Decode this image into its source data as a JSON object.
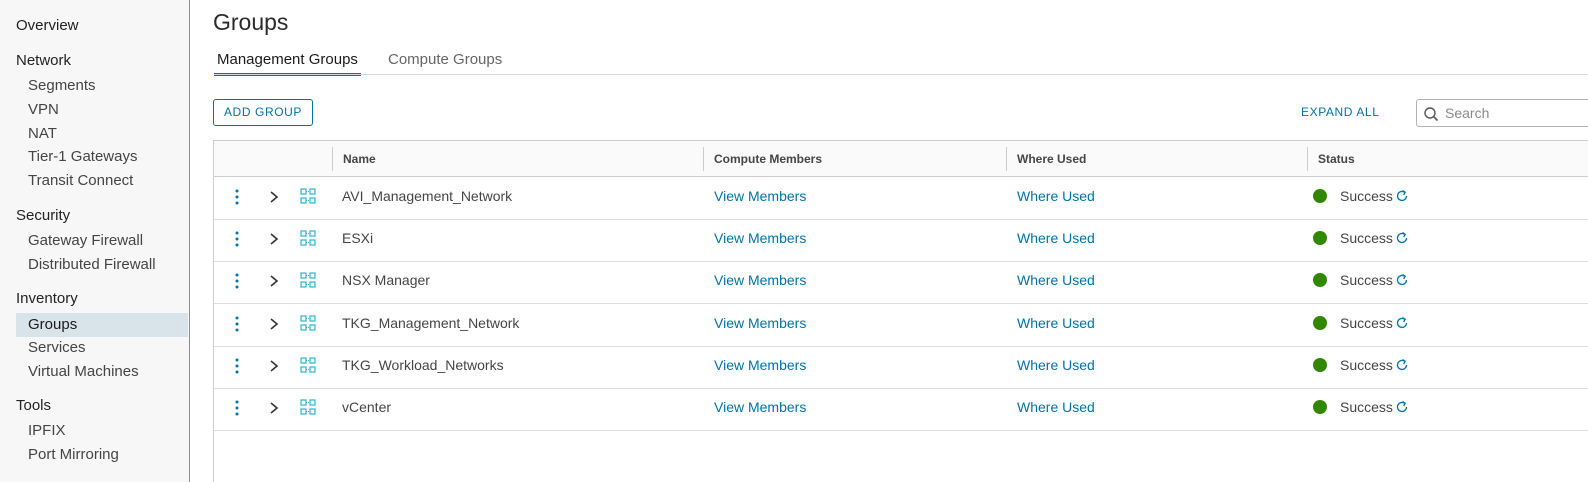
{
  "sidebar": {
    "overview": "Overview",
    "sections": [
      {
        "title": "Network",
        "items": [
          "Segments",
          "VPN",
          "NAT",
          "Tier-1 Gateways",
          "Transit Connect"
        ]
      },
      {
        "title": "Security",
        "items": [
          "Gateway Firewall",
          "Distributed Firewall"
        ]
      },
      {
        "title": "Inventory",
        "items": [
          "Groups",
          "Services",
          "Virtual Machines"
        ]
      },
      {
        "title": "Tools",
        "items": [
          "IPFIX",
          "Port Mirroring"
        ]
      }
    ],
    "active_item": "Groups"
  },
  "page": {
    "title": "Groups",
    "tabs": [
      {
        "label": "Management Groups",
        "active": true
      },
      {
        "label": "Compute Groups",
        "active": false
      }
    ],
    "add_group_label": "ADD GROUP",
    "expand_all_label": "EXPAND ALL",
    "search_placeholder": "Search"
  },
  "grid": {
    "columns": [
      "Name",
      "Compute Members",
      "Where Used",
      "Status"
    ],
    "rows": [
      {
        "name": "AVI_Management_Network",
        "members": "View Members",
        "where_used": "Where Used",
        "status": "Success"
      },
      {
        "name": "ESXi",
        "members": "View Members",
        "where_used": "Where Used",
        "status": "Success"
      },
      {
        "name": "NSX Manager",
        "members": "View Members",
        "where_used": "Where Used",
        "status": "Success"
      },
      {
        "name": "TKG_Management_Network",
        "members": "View Members",
        "where_used": "Where Used",
        "status": "Success"
      },
      {
        "name": "TKG_Workload_Networks",
        "members": "View Members",
        "where_used": "Where Used",
        "status": "Success"
      },
      {
        "name": "vCenter",
        "members": "View Members",
        "where_used": "Where Used",
        "status": "Success"
      }
    ]
  },
  "colors": {
    "accent": "#0072a3",
    "success": "#318700",
    "group_icon": "#2bb5c7"
  },
  "icons": {
    "row_menu": "vertical-ellipsis-icon",
    "expand": "chevron-right-icon",
    "group": "group-icon",
    "status": "status-dot-icon",
    "refresh": "refresh-icon",
    "search": "search-icon"
  }
}
